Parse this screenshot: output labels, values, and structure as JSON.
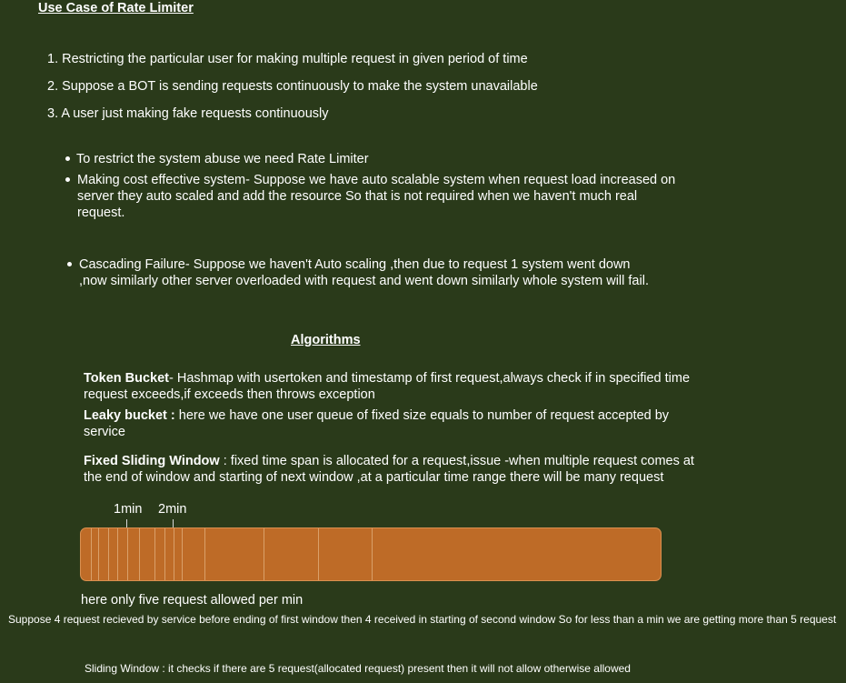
{
  "title": "Use Case of Rate Limiter",
  "use_cases": [
    "1. Restricting the particular user for making multiple request in given period of time",
    "2. Suppose a BOT is sending requests continuously to make the system unavailable",
    "3. A user just making fake requests continuously"
  ],
  "bullets_1": [
    [
      "To restrict the system abuse we need Rate Limiter"
    ],
    [
      "Making cost effective system- Suppose we have auto scalable system when request load increased on",
      "server they auto scaled and add the resource So that is not required when we haven't much real",
      "request."
    ]
  ],
  "bullet_2": [
    "Cascading Failure- Suppose we haven't Auto scaling ,then due to request 1 system went down",
    ",now similarly other server overloaded with request and went down similarly whole system will fail."
  ],
  "algorithms_title": "Algorithms",
  "algorithms": {
    "token_bucket": {
      "name": "Token Bucket",
      "text": "- Hashmap with usertoken and timestamp of first request,always check if in specified time request exceeds,if exceeds then throws exception"
    },
    "leaky_bucket": {
      "name": "Leaky bucket :",
      "text": " here we have one user queue of fixed size equals to number of request accepted by service"
    },
    "fixed_window": {
      "name": "Fixed Sliding Window",
      "text": " : fixed time span is allocated for a request,issue -when multiple request comes at the end of window and starting of next window ,at a particular time range there will be many request"
    }
  },
  "timeline": {
    "tick_labels": [
      "1min",
      "2min"
    ],
    "bar_color": "#be6b27"
  },
  "notes": {
    "allowed": "here only five request allowed per min",
    "example": "Suppose 4 request recieved by service before ending of first window then 4 received in starting of second window So for less than a min  we are getting more than 5 request",
    "sliding": "Sliding Window : it checks if there are 5 request(allocated request) present then it will not allow otherwise allowed"
  }
}
